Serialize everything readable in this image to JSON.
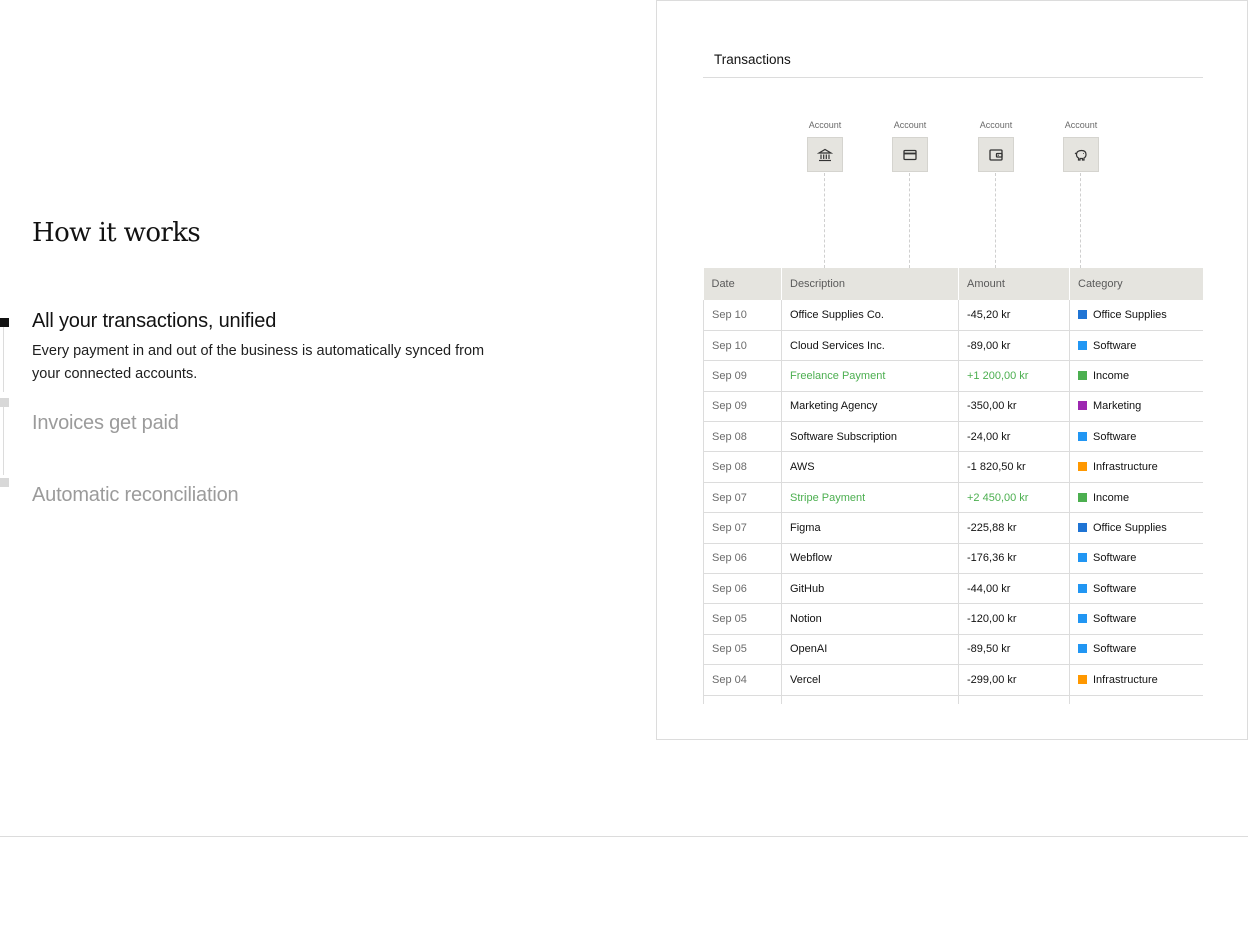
{
  "section": {
    "title": "How it works"
  },
  "steps": [
    {
      "title": "All your transactions, unified",
      "description": "Every payment in and out of the business is automatically synced from your connected accounts.",
      "active": true
    },
    {
      "title": "Invoices get paid",
      "active": false
    },
    {
      "title": "Automatic reconciliation",
      "active": false
    }
  ],
  "panel": {
    "title": "Transactions",
    "accounts": [
      {
        "label": "Account",
        "icon": "bank-icon"
      },
      {
        "label": "Account",
        "icon": "credit-card-icon"
      },
      {
        "label": "Account",
        "icon": "wallet-icon"
      },
      {
        "label": "Account",
        "icon": "piggy-bank-icon"
      }
    ],
    "table": {
      "headers": [
        "Date",
        "Description",
        "Amount",
        "Category"
      ],
      "rows": [
        {
          "date": "Sep 10",
          "description": "Office Supplies Co.",
          "amount": "-45,20 kr",
          "category": "Office Supplies",
          "color": "#1f74d4",
          "income": false
        },
        {
          "date": "Sep 10",
          "description": "Cloud Services Inc.",
          "amount": "-89,00 kr",
          "category": "Software",
          "color": "#2196f3",
          "income": false
        },
        {
          "date": "Sep 09",
          "description": "Freelance Payment",
          "amount": "+1 200,00 kr",
          "category": "Income",
          "color": "#4caf50",
          "income": true
        },
        {
          "date": "Sep 09",
          "description": "Marketing Agency",
          "amount": "-350,00 kr",
          "category": "Marketing",
          "color": "#9c27b0",
          "income": false
        },
        {
          "date": "Sep 08",
          "description": "Software Subscription",
          "amount": "-24,00 kr",
          "category": "Software",
          "color": "#2196f3",
          "income": false
        },
        {
          "date": "Sep 08",
          "description": "AWS",
          "amount": "-1 820,50 kr",
          "category": "Infrastructure",
          "color": "#ff9800",
          "income": false
        },
        {
          "date": "Sep 07",
          "description": "Stripe Payment",
          "amount": "+2 450,00 kr",
          "category": "Income",
          "color": "#4caf50",
          "income": true
        },
        {
          "date": "Sep 07",
          "description": "Figma",
          "amount": "-225,88 kr",
          "category": "Office Supplies",
          "color": "#1f74d4",
          "income": false
        },
        {
          "date": "Sep 06",
          "description": "Webflow",
          "amount": "-176,36 kr",
          "category": "Software",
          "color": "#2196f3",
          "income": false
        },
        {
          "date": "Sep 06",
          "description": "GitHub",
          "amount": "-44,00 kr",
          "category": "Software",
          "color": "#2196f3",
          "income": false
        },
        {
          "date": "Sep 05",
          "description": "Notion",
          "amount": "-120,00 kr",
          "category": "Software",
          "color": "#2196f3",
          "income": false
        },
        {
          "date": "Sep 05",
          "description": "OpenAI",
          "amount": "-89,50 kr",
          "category": "Software",
          "color": "#2196f3",
          "income": false
        },
        {
          "date": "Sep 04",
          "description": "Vercel",
          "amount": "-299,00 kr",
          "category": "Infrastructure",
          "color": "#ff9800",
          "income": false
        },
        {
          "date": "",
          "description": "",
          "amount": "",
          "category": "",
          "color": "",
          "income": false
        }
      ]
    }
  },
  "colors": {
    "active_text": "#121212",
    "inactive_text": "#9b9b9b",
    "income_text": "#4caf50",
    "header_bg": "#e5e4df"
  }
}
